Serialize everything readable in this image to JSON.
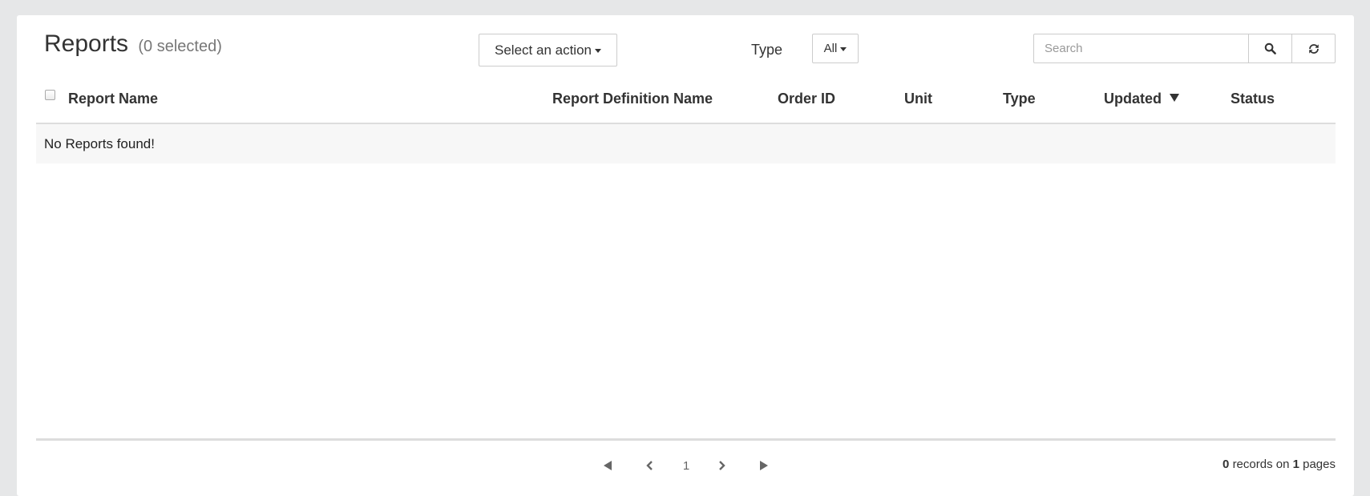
{
  "header": {
    "title": "Reports",
    "selected_text": "(0 selected)",
    "action_label": "Select an action",
    "type_label": "Type",
    "type_filter_value": "All",
    "search_placeholder": "Search"
  },
  "table": {
    "columns": [
      "Report Name",
      "Report Definition Name",
      "Order ID",
      "Unit",
      "Type",
      "Updated",
      "Status"
    ],
    "sorted_column": "Updated",
    "sort_direction": "descending",
    "empty_message": "No Reports found!"
  },
  "pagination": {
    "current_page": "1",
    "record_count": "0",
    "records_text": "records on",
    "page_count": "1",
    "pages_text": "pages"
  },
  "icons": {
    "search": "search-icon",
    "refresh": "refresh-icon",
    "first": "first-page-icon",
    "prev": "prev-page-icon",
    "next": "next-page-icon",
    "last": "last-page-icon"
  },
  "colors": {
    "background": "#e6e7e8",
    "panel": "#ffffff",
    "empty_row": "#f7f7f7",
    "border": "#cccccc"
  }
}
